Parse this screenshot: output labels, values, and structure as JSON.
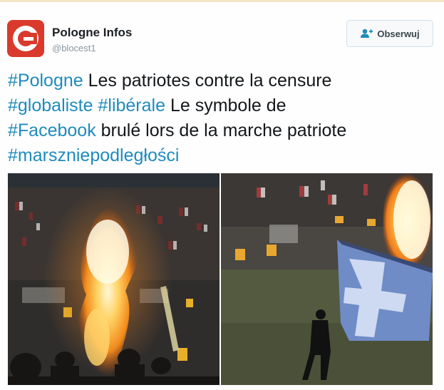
{
  "account": {
    "display_name": "Pologne Infos",
    "handle": "@blocest1"
  },
  "follow_button": {
    "label": "Obserwuj",
    "icon": "add-user-icon"
  },
  "tweet": {
    "lines": [
      [
        {
          "text": "#Pologne",
          "type": "hashtag"
        },
        {
          "text": " Les patriotes contre la censure",
          "type": "text"
        }
      ],
      [
        {
          "text": "#globaliste",
          "type": "hashtag"
        },
        {
          "text": " ",
          "type": "text"
        },
        {
          "text": "#libérale",
          "type": "hashtag"
        },
        {
          "text": " Le symbole de",
          "type": "text"
        }
      ],
      [
        {
          "text": "#Facebook",
          "type": "hashtag"
        },
        {
          "text": " brulé lors de la marche patriote",
          "type": "text"
        }
      ],
      [
        {
          "text": "#marszniepodległości",
          "type": "hashtag"
        }
      ]
    ]
  },
  "colors": {
    "hashtag": "#1f8bbc",
    "text": "#14171a",
    "avatar": "#d93a2c"
  }
}
